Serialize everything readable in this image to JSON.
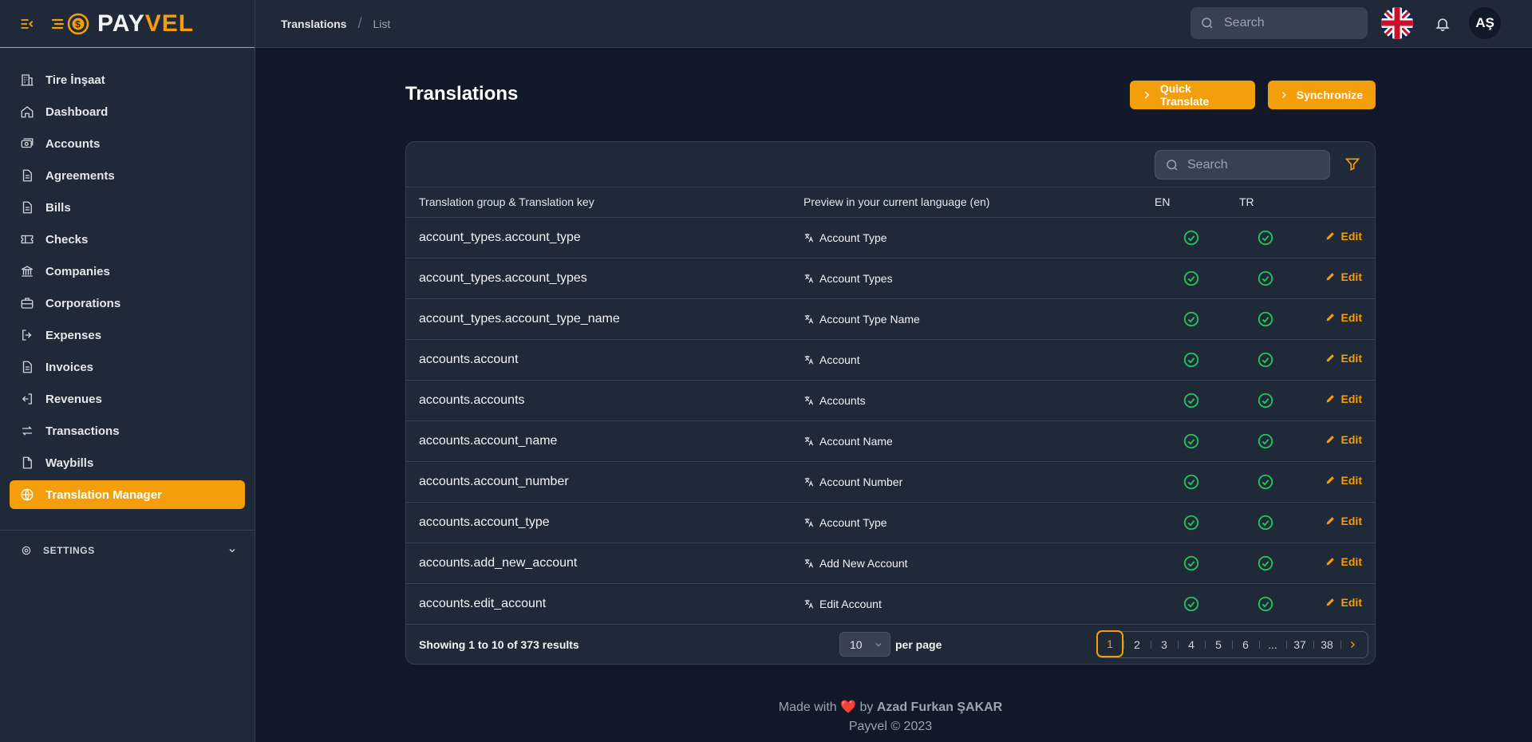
{
  "brand": {
    "name_part1": "PAY",
    "name_part2": "VEL"
  },
  "sidebar": {
    "items": [
      {
        "label": "Tire İnşaat",
        "icon": "building-icon"
      },
      {
        "label": "Dashboard",
        "icon": "home-icon"
      },
      {
        "label": "Accounts",
        "icon": "cash-icon"
      },
      {
        "label": "Agreements",
        "icon": "document-icon"
      },
      {
        "label": "Bills",
        "icon": "document-icon"
      },
      {
        "label": "Checks",
        "icon": "ticket-icon"
      },
      {
        "label": "Companies",
        "icon": "bank-icon"
      },
      {
        "label": "Corporations",
        "icon": "briefcase-icon"
      },
      {
        "label": "Expenses",
        "icon": "logout-icon"
      },
      {
        "label": "Invoices",
        "icon": "document-icon"
      },
      {
        "label": "Revenues",
        "icon": "login-icon"
      },
      {
        "label": "Transactions",
        "icon": "arrows-icon"
      },
      {
        "label": "Waybills",
        "icon": "file-icon"
      },
      {
        "label": "Translation Manager",
        "icon": "globe-icon",
        "active": true
      }
    ],
    "settings_label": "SETTINGS"
  },
  "topbar": {
    "breadcrumb": [
      "Translations",
      "List"
    ],
    "search_placeholder": "Search",
    "avatar_initials": "AŞ"
  },
  "main": {
    "title": "Translations",
    "buttons": {
      "quick_translate": "Quick Translate",
      "synchronize": "Synchronize"
    },
    "table_search_placeholder": "Search",
    "columns": {
      "key": "Translation group & Translation key",
      "preview": "Preview in your current language (en)",
      "en": "EN",
      "tr": "TR"
    },
    "edit_label": "Edit",
    "rows": [
      {
        "key": "account_types.account_type",
        "preview": "Account Type"
      },
      {
        "key": "account_types.account_types",
        "preview": "Account Types"
      },
      {
        "key": "account_types.account_type_name",
        "preview": "Account Type Name"
      },
      {
        "key": "accounts.account",
        "preview": "Account"
      },
      {
        "key": "accounts.accounts",
        "preview": "Accounts"
      },
      {
        "key": "accounts.account_name",
        "preview": "Account Name"
      },
      {
        "key": "accounts.account_number",
        "preview": "Account Number"
      },
      {
        "key": "accounts.account_type",
        "preview": "Account Type"
      },
      {
        "key": "accounts.add_new_account",
        "preview": "Add New Account"
      },
      {
        "key": "accounts.edit_account",
        "preview": "Edit Account"
      }
    ],
    "pagination": {
      "results_text": "Showing 1 to 10 of 373 results",
      "per_page_value": "10",
      "per_page_label": "per page",
      "pages": [
        "1",
        "2",
        "3",
        "4",
        "5",
        "6",
        "...",
        "37",
        "38"
      ],
      "current": "1"
    }
  },
  "footer": {
    "made_with": "Made with",
    "by": "by",
    "author": "Azad Furkan ŞAKAR",
    "copyright": "Payvel © 2023"
  },
  "colors": {
    "accent": "#f59e0b",
    "success": "#22c55e",
    "background": "#111827",
    "surface": "#1f2937"
  }
}
